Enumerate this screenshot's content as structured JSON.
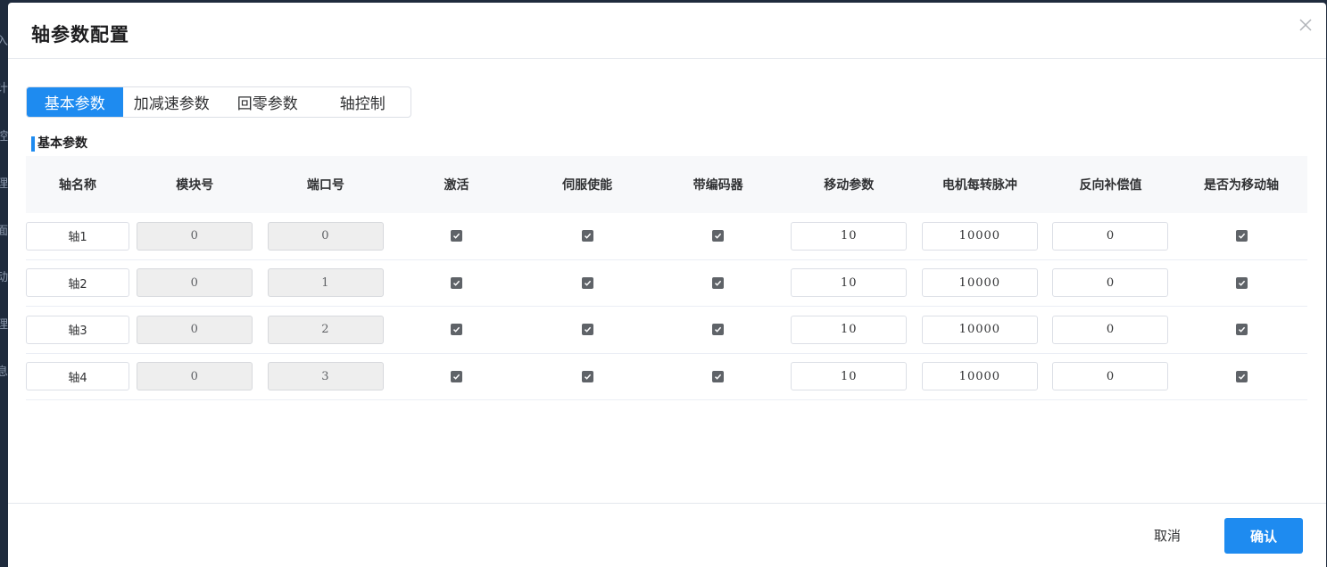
{
  "background": {
    "sidebar_fragments": [
      "入",
      "计",
      "控",
      "理",
      "面",
      "动",
      "理",
      "息"
    ]
  },
  "dialog": {
    "title": "轴参数配置",
    "close_icon": "close-icon"
  },
  "tabs": [
    {
      "label": "基本参数",
      "active": true
    },
    {
      "label": "加减速参数",
      "active": false
    },
    {
      "label": "回零参数",
      "active": false
    },
    {
      "label": "轴控制",
      "active": false
    }
  ],
  "section_title": "基本参数",
  "table": {
    "headers": [
      "轴名称",
      "模块号",
      "端口号",
      "激活",
      "伺服使能",
      "带编码器",
      "移动参数",
      "电机每转脉冲",
      "反向补偿值",
      "是否为移动轴"
    ],
    "rows": [
      {
        "name": "轴1",
        "module": "0",
        "port": "0",
        "active": true,
        "servo": true,
        "encoder": true,
        "move": "10",
        "pulse": "10000",
        "backlash": "0",
        "is_move_axis": true
      },
      {
        "name": "轴2",
        "module": "0",
        "port": "1",
        "active": true,
        "servo": true,
        "encoder": true,
        "move": "10",
        "pulse": "10000",
        "backlash": "0",
        "is_move_axis": true
      },
      {
        "name": "轴3",
        "module": "0",
        "port": "2",
        "active": true,
        "servo": true,
        "encoder": true,
        "move": "10",
        "pulse": "10000",
        "backlash": "0",
        "is_move_axis": true
      },
      {
        "name": "轴4",
        "module": "0",
        "port": "3",
        "active": true,
        "servo": true,
        "encoder": true,
        "move": "10",
        "pulse": "10000",
        "backlash": "0",
        "is_move_axis": true
      }
    ]
  },
  "footer": {
    "cancel_label": "取消",
    "confirm_label": "确认"
  },
  "colors": {
    "accent": "#1e8bf0",
    "checkbox": "#5f6368",
    "disabled_bg": "#eeeeee"
  }
}
